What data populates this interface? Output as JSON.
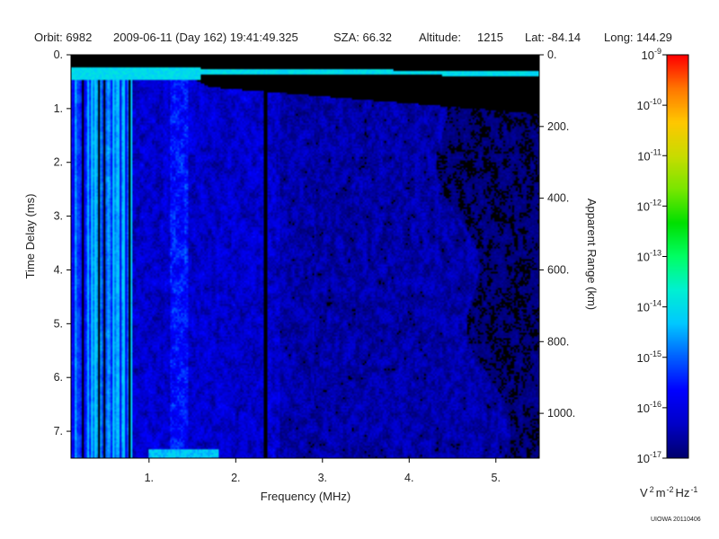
{
  "header": {
    "orbit": "Orbit: 6982",
    "datetime": "2009-06-11 (Day 162) 19:41:49.325",
    "sza": "SZA:  66.32",
    "altitude_label": "Altitude:",
    "altitude_value": "1215",
    "lat": "Lat: -84.14",
    "long": "Long: 144.29"
  },
  "credit": "UIOWA 20110406",
  "colors": {
    "background": "#000000",
    "colormap": [
      "#00006e",
      "#0000c8",
      "#0000ff",
      "#0060ff",
      "#00c8ff",
      "#00f0d2",
      "#00ff64",
      "#00e000",
      "#78e600",
      "#c8dc00",
      "#ffc800",
      "#ff7800",
      "#ff0000"
    ]
  },
  "chart_data": {
    "type": "heatmap",
    "x_axis": {
      "label": "Frequency (MHz)",
      "range": [
        0.1,
        5.5
      ],
      "ticks": [
        {
          "value": 1,
          "label": "1."
        },
        {
          "value": 2,
          "label": "2."
        },
        {
          "value": 3,
          "label": "3."
        },
        {
          "value": 4,
          "label": "4."
        },
        {
          "value": 5,
          "label": "5."
        }
      ]
    },
    "y_axis": {
      "label": "Time Delay (ms)",
      "range": [
        0,
        7.5
      ],
      "inverted": true,
      "ticks": [
        {
          "value": 0,
          "label": "0."
        },
        {
          "value": 1,
          "label": "1."
        },
        {
          "value": 2,
          "label": "2."
        },
        {
          "value": 3,
          "label": "3."
        },
        {
          "value": 4,
          "label": "4."
        },
        {
          "value": 5,
          "label": "5."
        },
        {
          "value": 6,
          "label": "6."
        },
        {
          "value": 7,
          "label": "7."
        }
      ]
    },
    "y2_axis": {
      "label": "Apparent Range (km)",
      "range": [
        0,
        1125
      ],
      "ticks": [
        {
          "value": 0,
          "label": "0."
        },
        {
          "value": 200,
          "label": "200."
        },
        {
          "value": 400,
          "label": "400."
        },
        {
          "value": 600,
          "label": "600."
        },
        {
          "value": 800,
          "label": "800."
        },
        {
          "value": 1000,
          "label": "1000."
        }
      ]
    },
    "colorbar": {
      "unit": {
        "v": "V",
        "v_exp": "2",
        "m": "m",
        "m_exp": "-2",
        "hz": "Hz",
        "hz_exp": "-1"
      },
      "scale": "log",
      "range_exponents": [
        -17,
        -9
      ],
      "ticks": [
        {
          "base": "10",
          "exp": "-9"
        },
        {
          "base": "10",
          "exp": "-10"
        },
        {
          "base": "10",
          "exp": "-11"
        },
        {
          "base": "10",
          "exp": "-12"
        },
        {
          "base": "10",
          "exp": "-13"
        },
        {
          "base": "10",
          "exp": "-14"
        },
        {
          "base": "10",
          "exp": "-15"
        },
        {
          "base": "10",
          "exp": "-16"
        },
        {
          "base": "10",
          "exp": "-17"
        }
      ]
    },
    "features": {
      "surface_echo": {
        "x_start": 0.1,
        "x_end": 5.5,
        "y_start": 0.25,
        "y_end": 0.35,
        "log_power": -13.8
      },
      "diffuse_echo_cutoff": {
        "x_start": 1.7,
        "y_start": 0.6,
        "x_end": 5.5,
        "y_end": 1.1
      },
      "dark_gap": {
        "x_start": 2.33,
        "x_end": 2.37
      },
      "bright_column": {
        "x_start": 1.25,
        "x_end": 1.45,
        "log_power": -15.5
      },
      "low_freq_bottom_strip": {
        "x_start": 1.0,
        "x_end": 1.8,
        "y_start": 7.35,
        "y_end": 7.5,
        "log_power": -14.0
      },
      "low_freq_streaks": {
        "x_start": 0.1,
        "x_end": 0.8,
        "log_power_max": -14.2
      }
    }
  }
}
